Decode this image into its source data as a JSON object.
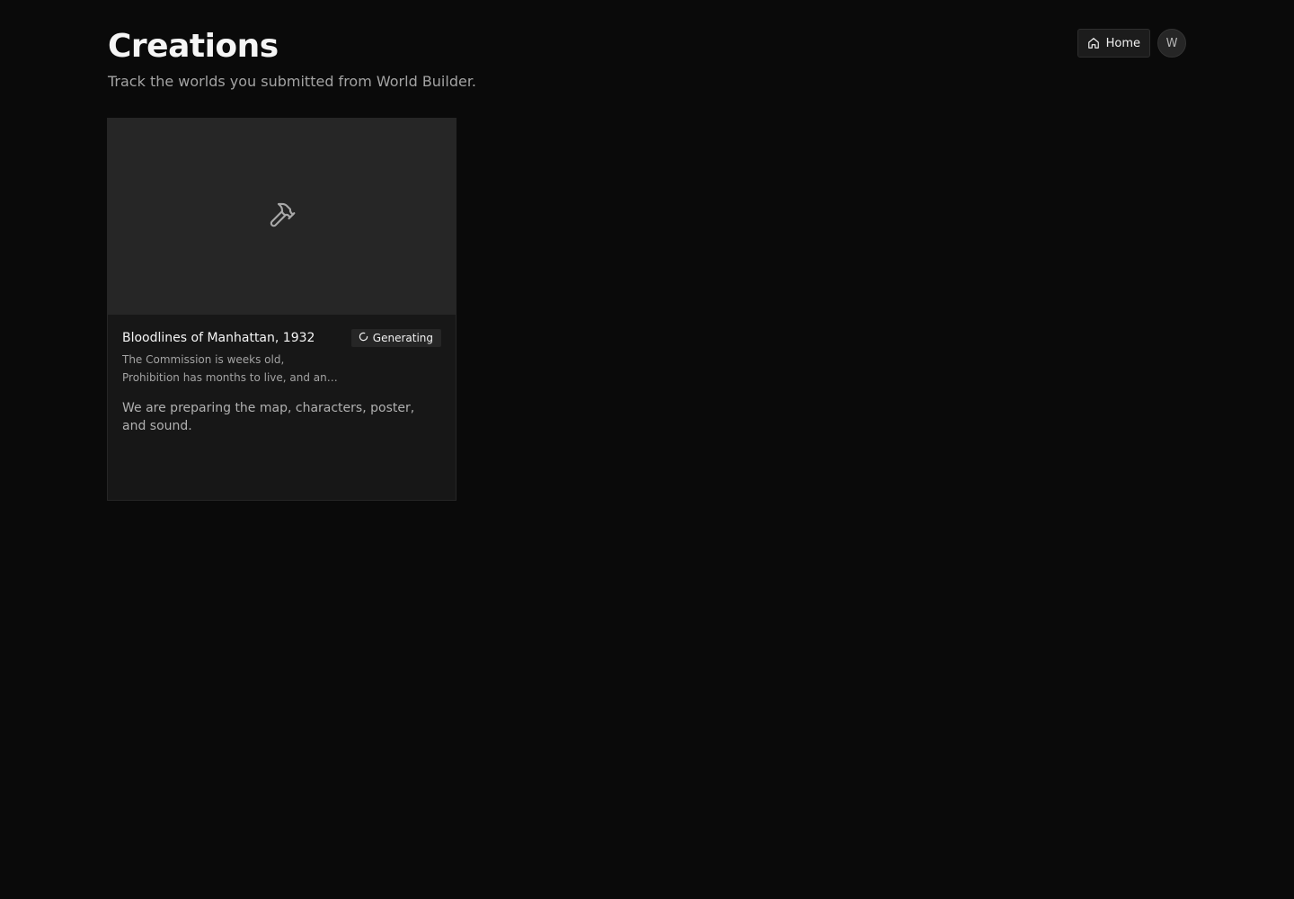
{
  "header": {
    "title": "Creations",
    "subtitle": "Track the worlds you submitted from World Builder."
  },
  "nav": {
    "home_label": "Home",
    "home_icon": "home-icon",
    "avatar_initial": "W"
  },
  "creations": [
    {
      "title": "Bloodlines of Manhattan, 1932",
      "description": "The Commission is weeks old, Prohibition has months to live, and an ambitious...",
      "status_label": "Generating",
      "status_icon": "spinner-icon",
      "status_message": "We are preparing the map, characters, poster, and sound.",
      "thumbnail_icon": "hammer-icon"
    }
  ],
  "colors": {
    "background": "#0a0a0a",
    "card": "#171717",
    "thumbnail": "#262626",
    "muted_text": "#a3a3a3"
  }
}
